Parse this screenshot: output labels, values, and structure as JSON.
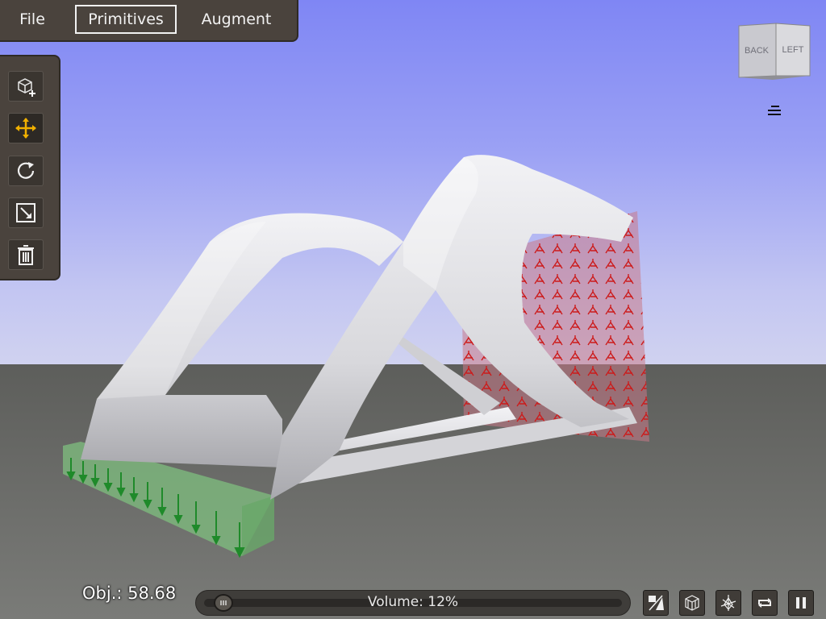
{
  "menu": {
    "file": "File",
    "primitives": "Primitives",
    "augment": "Augment"
  },
  "toolbar": {
    "tools": [
      {
        "name": "add-primitive",
        "icon": "cube-plus-icon",
        "active": false
      },
      {
        "name": "move",
        "icon": "move-arrows-icon",
        "active": true
      },
      {
        "name": "rotate",
        "icon": "rotate-icon",
        "active": false
      },
      {
        "name": "scale",
        "icon": "scale-icon",
        "active": false
      },
      {
        "name": "delete",
        "icon": "trash-icon",
        "active": false
      }
    ]
  },
  "viewcube": {
    "back": "BACK",
    "left": "LEFT"
  },
  "bottom": {
    "objective_label": "Obj.: 58.68",
    "volume_label": "Volume: 12%",
    "volume_fraction": 0.12
  },
  "colors": {
    "active_tool": "#f0b000",
    "load_arrows": "#d22020",
    "support_arrows": "#1f8a2a"
  }
}
